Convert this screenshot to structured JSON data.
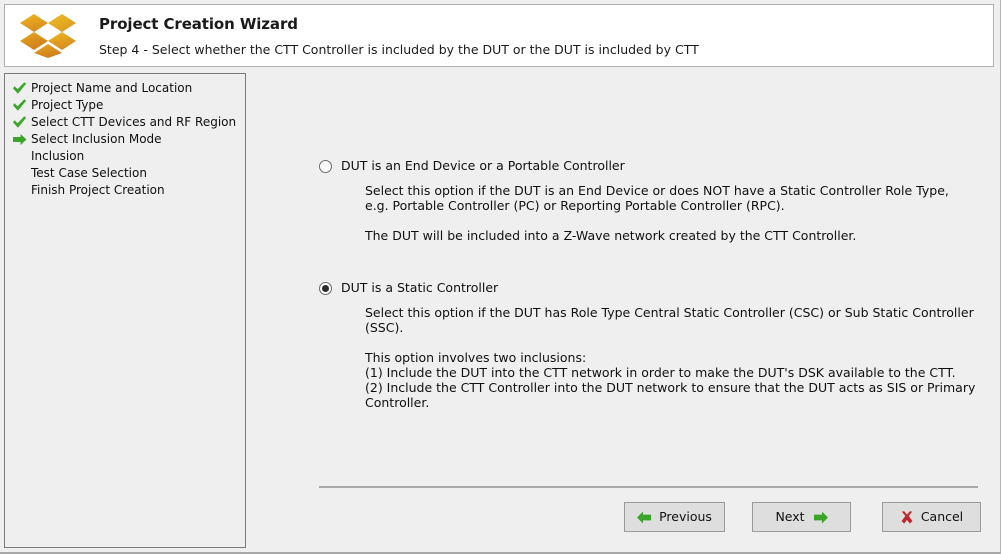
{
  "header": {
    "logo_icon": "dropbox-style-diamond-logo",
    "title": "Project Creation Wizard",
    "subtitle": "Step 4 - Select whether the CTT Controller is included by the DUT or the DUT is included by CTT"
  },
  "sidebar": {
    "steps": [
      {
        "label": "Project Name and Location",
        "state": "done",
        "icon": "check-icon"
      },
      {
        "label": "Project Type",
        "state": "done",
        "icon": "check-icon"
      },
      {
        "label": "Select CTT Devices and RF Region",
        "state": "done",
        "icon": "check-icon"
      },
      {
        "label": "Select Inclusion Mode",
        "state": "current",
        "icon": "arrow-right-icon"
      },
      {
        "label": "Inclusion",
        "state": "pending",
        "icon": "none"
      },
      {
        "label": "Test Case Selection",
        "state": "pending",
        "icon": "none"
      },
      {
        "label": "Finish Project Creation",
        "state": "pending",
        "icon": "none"
      }
    ]
  },
  "main": {
    "options": [
      {
        "title": "DUT is an End Device or a Portable Controller",
        "selected": false,
        "paragraphs": [
          "Select this option if the DUT is an End Device or does NOT have a Static Controller Role Type,\ne.g. Portable Controller (PC) or Reporting Portable Controller (RPC).",
          "The DUT will be included into a Z-Wave network created by the CTT Controller."
        ]
      },
      {
        "title": "DUT is a Static Controller",
        "selected": true,
        "paragraphs": [
          "Select this option if the DUT has Role Type Central Static Controller (CSC) or Sub Static Controller (SSC).",
          "This option involves two inclusions:\n(1) Include the DUT into the CTT network in order to make the DUT's DSK available to the CTT.\n(2) Include the CTT Controller into the DUT network to ensure that the DUT acts as SIS or Primary Controller."
        ]
      }
    ]
  },
  "footer": {
    "previous_label": "Previous",
    "previous_icon": "arrow-left-icon",
    "next_label": "Next",
    "next_icon": "arrow-right-icon",
    "cancel_label": "Cancel",
    "cancel_icon": "close-x-icon"
  },
  "colors": {
    "accent_green": "#3aa528",
    "cancel_red": "#c0272d",
    "logo_gold": "#e8b424",
    "logo_orange": "#d98b1e",
    "window_bg": "#efefef",
    "panel_white": "#ffffff"
  }
}
